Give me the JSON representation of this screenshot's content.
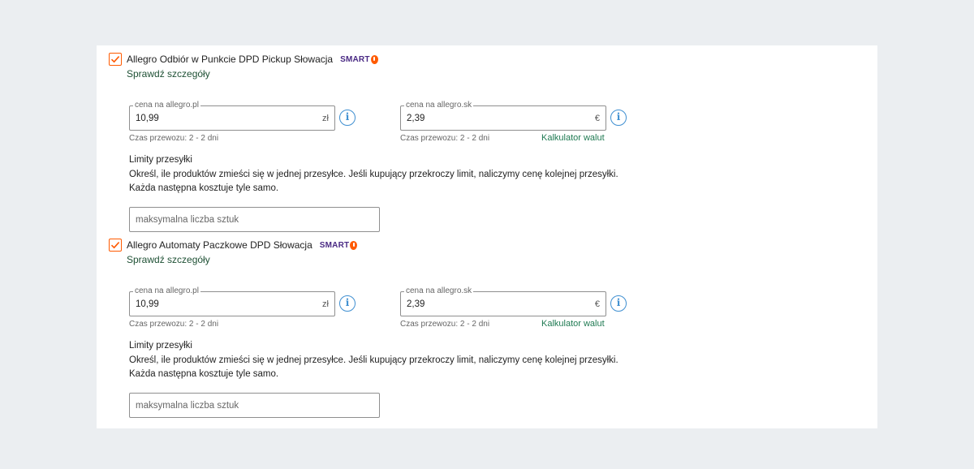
{
  "methods": [
    {
      "checked": true,
      "title": "Allegro Odbiór w Punkcie DPD Pickup Słowacja",
      "badge": "SMART",
      "details_link": "Sprawdź szczegóły",
      "price_pl": {
        "label": "cena na allegro.pl",
        "value": "10,99",
        "currency": "zł",
        "transit": "Czas przewozu: 2 - 2 dni"
      },
      "price_sk": {
        "label": "cena na allegro.sk",
        "value": "2,39",
        "currency": "€",
        "transit": "Czas przewozu: 2 - 2 dni"
      },
      "currency_calculator": "Kalkulator walut",
      "limits_title": "Limity przesyłki",
      "limits_desc_line1": "Określ, ile produktów zmieści się w jednej przesyłce. Jeśli kupujący przekroczy limit, naliczymy cenę kolejnej przesyłki.",
      "limits_desc_line2": "Każda następna kosztuje tyle samo.",
      "max_qty_placeholder": "maksymalna liczba sztuk"
    },
    {
      "checked": true,
      "title": "Allegro Automaty Paczkowe DPD Słowacja",
      "badge": "SMART",
      "details_link": "Sprawdź szczegóły",
      "price_pl": {
        "label": "cena na allegro.pl",
        "value": "10,99",
        "currency": "zł",
        "transit": "Czas przewozu: 2 - 2 dni"
      },
      "price_sk": {
        "label": "cena na allegro.sk",
        "value": "2,39",
        "currency": "€",
        "transit": "Czas przewozu: 2 - 2 dni"
      },
      "currency_calculator": "Kalkulator walut",
      "limits_title": "Limity przesyłki",
      "limits_desc_line1": "Określ, ile produktów zmieści się w jednej przesyłce. Jeśli kupujący przekroczy limit, naliczymy cenę kolejnej przesyłki.",
      "limits_desc_line2": "Każda następna kosztuje tyle samo.",
      "max_qty_placeholder": "maksymalna liczba sztuk"
    }
  ],
  "colors": {
    "accent": "#ff5a00",
    "link": "#1f5135",
    "calc_link": "#1f7a52",
    "info": "#3f8fd1",
    "smart": "#4a2a84"
  },
  "icons": {
    "check": "checkmark-icon",
    "info": "info-icon",
    "smart": "smart-drop-icon"
  }
}
